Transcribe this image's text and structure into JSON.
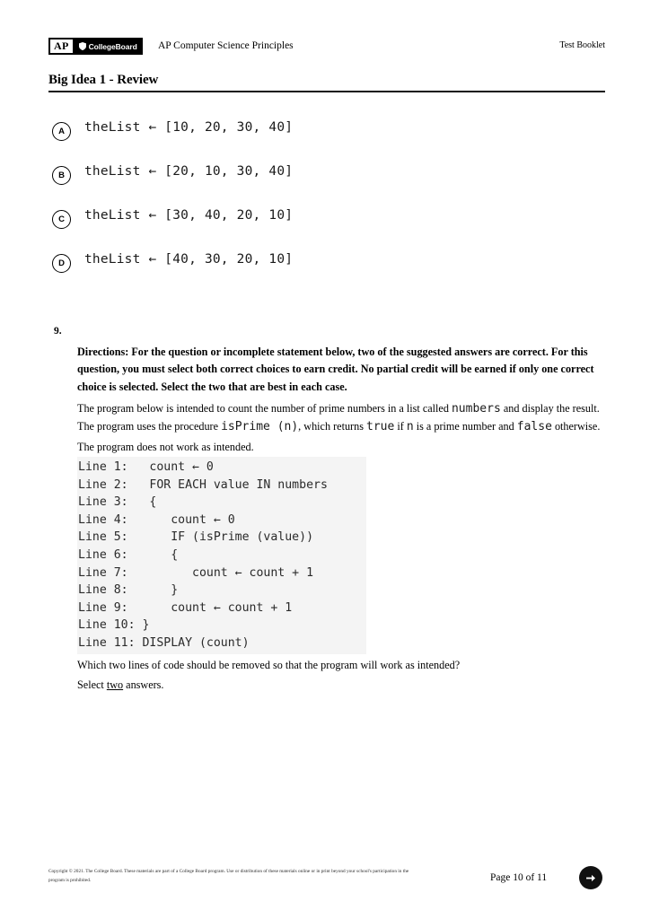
{
  "header": {
    "logo_ap": "AP",
    "logo_collegeboard": "CollegeBoard",
    "shield_icon": "shield-icon",
    "subject": "AP Computer Science Principles",
    "booklet_label": "Test Booklet"
  },
  "title": {
    "text": "Big Idea 1 - Review"
  },
  "options": [
    {
      "letter": "A",
      "code": "theList ← [10, 20, 30, 40]"
    },
    {
      "letter": "B",
      "code": "theList ← [20, 10, 30, 40]"
    },
    {
      "letter": "C",
      "code": "theList ← [30, 40, 20, 10]"
    },
    {
      "letter": "D",
      "code": "theList ← [40, 30, 20, 10]"
    }
  ],
  "question": {
    "number": "9.",
    "directions": "Directions: For the question or incomplete statement below, two of the suggested answers are correct. For this question, you must select both correct choices to earn credit. No partial credit will be earned if only one correct choice is selected. Select the two that are best in each case.",
    "prose_part1": "The program below is intended to count the number of prime numbers in a list called ",
    "prose_mono1": "numbers",
    "prose_part2": " and display the result. The program uses the procedure ",
    "prose_mono2": "isPrime (n)",
    "prose_part3": ", which returns ",
    "prose_mono3": "true",
    "prose_part4": " if ",
    "prose_mono4": "n",
    "prose_part5": " is a prime number and ",
    "prose_mono5": "false",
    "prose_part6": " otherwise.",
    "not_intended": "The program does not work as intended.",
    "code_lines": [
      "Line 1:   count ← 0",
      "Line 2:   FOR EACH value IN numbers",
      "Line 3:   {",
      "Line 4:      count ← 0",
      "Line 5:      IF (isPrime (value))",
      "Line 6:      {",
      "Line 7:         count ← count + 1",
      "Line 8:      }",
      "Line 9:      count ← count + 1",
      "Line 10: }",
      "Line 11: DISPLAY (count)"
    ],
    "tail_question": "Which two lines of code should be removed so that the program will work as intended?",
    "select_prefix": "Select ",
    "select_emphasis": "two",
    "select_suffix": " answers."
  },
  "footer": {
    "copyright": "Copyright © 2021. The College Board. These materials are part of a College Board program. Use or distribution of these materials online or in print beyond your school's participation in the program is prohibited.",
    "page_label": "Page 10 of 11",
    "next_icon": "arrow-right-icon"
  },
  "colors": {
    "logo_background": "#000000",
    "rule": "#111111",
    "code_background": "#f4f4f4",
    "next_button": "#111111"
  }
}
